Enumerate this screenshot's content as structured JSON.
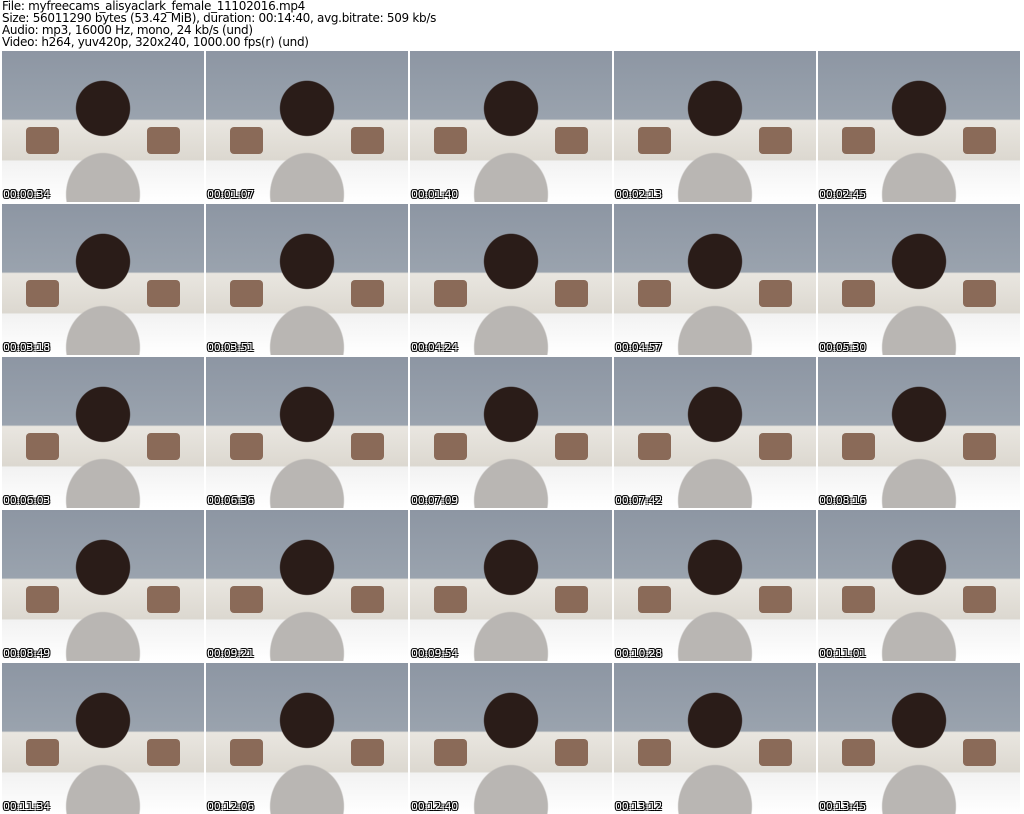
{
  "header": {
    "file_line": "File: myfreecams_alisyaclark_female_11102016.mp4",
    "size_line": "Size: 56011290 bytes (53.42 MiB), duration: 00:14:40, avg.bitrate: 509 kb/s",
    "audio_line": "Audio: mp3, 16000 Hz, mono, 24 kb/s (und)",
    "video_line": "Video: h264, yuv420p, 320x240, 1000.00 fps(r) (und)"
  },
  "thumbnails": [
    "00:00:34",
    "00:01:07",
    "00:01:40",
    "00:02:13",
    "00:02:45",
    "00:03:18",
    "00:03:51",
    "00:04:24",
    "00:04:57",
    "00:05:30",
    "00:06:03",
    "00:06:36",
    "00:07:09",
    "00:07:42",
    "00:08:16",
    "00:08:49",
    "00:09:21",
    "00:09:54",
    "00:10:28",
    "00:11:01",
    "00:11:34",
    "00:12:06",
    "00:12:40",
    "00:13:12",
    "00:13:45"
  ]
}
